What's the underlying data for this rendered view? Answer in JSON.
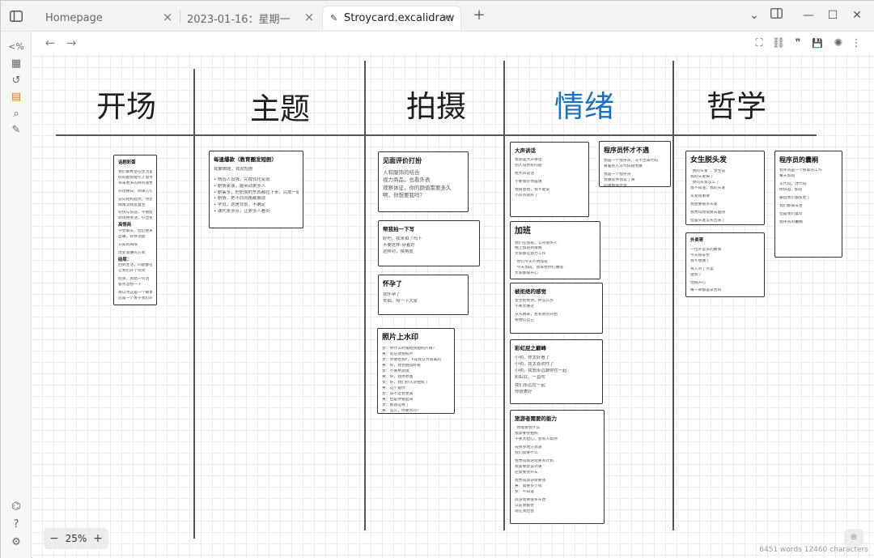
{
  "tabs": [
    {
      "label": "Homepage",
      "active": false
    },
    {
      "label": "2023-01-16：星期一",
      "active": false
    },
    {
      "label": "Stroycard.excalidraw",
      "active": true
    }
  ],
  "icons": {
    "sidebar_toggle": "sidebar-toggle-icon",
    "close": "×",
    "new_tab": "+",
    "back": "←",
    "forward": "→",
    "chevron": "⌄",
    "layout": "▣",
    "minimize": "—",
    "maximize": "☐",
    "win_close": "✕",
    "ribbon": [
      "<%",
      "▦",
      "↺",
      "▤",
      "⌕",
      "✎"
    ],
    "ribbon_bottom": [
      "⌬",
      "?",
      "⚙"
    ],
    "tools": [
      "⛶",
      "⛓",
      "❞",
      "💾",
      "✺",
      "⋮"
    ]
  },
  "headings": [
    "开场",
    "主题",
    "拍摄",
    "情绪",
    "哲学"
  ],
  "colors": {
    "accent": "#e07b2a",
    "heading_blue": "#1971c2"
  },
  "cards": {
    "c1": {
      "title": "话剧彩蛋",
      "lines": [
        "我们都希望在生活里看一出",
        "好的剧目能引人思考与",
        "带来更多的共鸣感觉",
        "",
        "开场独白，简单几句",
        "",
        "逆向结构起伏，然后推进结尾",
        "情绪流线反复至",
        "",
        "欢快与伤悲，平衡起伏",
        "转场用笑话，引出整体主题情绪"
      ],
      "section2": "高情商",
      "lines2": [
        "学会聊天，拉近距离",
        "自嘲，转移话题",
        "",
        "认知的局限",
        "",
        "改变思维的方式"
      ],
      "section3": "结尾：",
      "lines3": [
        "回到生活，问题都在哪里",
        "让我们开个玩笑",
        "",
        "结束，总结一句话",
        "留点念想一下",
        "",
        "我以为这是一个故事",
        "这是一个关于我们的故事"
      ]
    },
    "c2": {
      "title": "每逢爆款（教育圈发短剧）",
      "intro": "我要做题，我就短剧",
      "bullets": [
        "情感人设强，完成转化变现",
        "剧情紧凑，能带动更多人",
        "剧集多，把积攒的东西都拉下来，完成一组",
        "剧情，把不同风格都展现",
        "学员，这是背景，不确定",
        "课代表多点，让更多人看到"
      ]
    },
    "c3": {
      "title": "见面评价打扮",
      "lines": [
        "人和服饰的结合",
        "视力商品，也看外表",
        "观察体征，你的颜值需要多久",
        "啊，你想要我吗？"
      ]
    },
    "c4": {
      "title": "帮我拍一下写",
      "lines": [
        "好吧，我来拍了吗下",
        "不要这样-穿着好",
        "这样对，换角度"
      ]
    },
    "c5": {
      "title": "怀孕了",
      "lines": [
        "我怀孕了",
        "去拍，照一下大家"
      ]
    },
    "c6": {
      "title": "照片上水印",
      "lines": [
        "女：你什么时候给我拍照片啊？",
        "男：现在就拍照片",
        "女：你要给我P，P成我认为很美的",
        "男：好，我会拍得好看",
        "女：不要用滤镜",
        "男：好，我用原图",
        "女：好，我们好久没拍照了",
        "男：这个是你",
        "女：说不定会更美",
        "男：但是你看起来",
        "女：那就这样了",
        "男：怎么，你要水印？",
        "女：好，加上吧",
        "男：你说",
        "女：好吧",
        "“看水印就知道我拍”",
        "只有我一个人拍照"
      ]
    },
    "c7": {
      "title": "大声讲话",
      "lines": [
        "我总是大声讲话",
        "别人说我有问题",
        "",
        "我大声说话",
        "",
        "不要假装你是谁",
        "",
        "我很害怕，我不能说",
        "小声点就好了"
      ]
    },
    "c8": {
      "title": "程序员怀才不遇",
      "lines": [
        "我是一个程序员，写不出来代码",
        "看着别人写代码很羡慕",
        "",
        "我是一个程序员",
        "我做软件我说了算",
        "同事都很厉害"
      ]
    },
    "c9": {
      "title": "加班",
      "lines": [
        "我们在加班，公司很多人",
        "晚上加班到很晚",
        "大家都在努力工作",
        "",
        "“你们今天不用加班”",
        "“今天加班，我来给你们做饭”",
        "大家都很开心"
      ]
    },
    "c10": {
      "title": "被拒绝的感觉",
      "lines": [
        "女生拒绝你，你怎么办",
        "不要太难过",
        "",
        "从头再来，会有新的开始",
        "要相信自己"
      ]
    },
    "c11": {
      "title": "彩虹屁之巅峰",
      "lines": [
        "小明，你太好看了",
        "小明，我太喜欢你了",
        "小明，我想永远跟你在一起",
        "彩虹屁，一直吹",
        "",
        "我们永远在一起",
        "你很美好"
      ]
    },
    "c12": {
      "title": "旅游者需要的能力",
      "lines": [
        "“你需要会什么”",
        "我需要会拍照",
        "不要太担心，会有人帮你",
        "",
        "去很多地方旅游",
        "我们需要什么",
        "",
        "我觉得旅游需要有计划",
        "我需要会说外语",
        "还需要会开车",
        "",
        "我觉得旅游需要钱",
        "男：需要多少钱",
        "女：不知道",
        "",
        "旅游需要很多东西",
        "以前我都会",
        "现在我也会"
      ]
    },
    "c13": {
      "title": "女生脱头发",
      "lines": [
        "“我的头发”，女生说",
        "我的头发掉了",
        "“你的头发怎么了”",
        "我不知道，我的头发",
        "",
        "头发很重要",
        "",
        "我想要很多头发",
        "",
        "我觉得我需要去医院",
        "",
        "但是头发又长出来了",
        "",
        "女生很开心"
      ]
    },
    "c14": {
      "title": "外卖哥",
      "lines": [
        "一位外卖员的故事",
        "今天很辛苦",
        "我不想做了",
        "",
        "有人点了外卖",
        "送到了",
        "",
        "他很开心",
        "",
        "每一单都是辛苦的",
        "",
        "我觉得生活不容易",
        "",
        "但是要坚持"
      ]
    },
    "c15": {
      "title": "程序员的囊桐",
      "lines": [
        "程序员是一个很累的工作",
        "每天加班",
        "",
        "写代码，改代码",
        "修bug，加班",
        "",
        "最后我们都变老了",
        "",
        "我们都很辛苦",
        "",
        "但是我们喜欢",
        "",
        "程序员的囊桐"
      ]
    }
  },
  "zoom": {
    "minus": "−",
    "value": "25%",
    "plus": "+"
  },
  "status": "6451 words 12460 characters",
  "corner_icon": "⦾"
}
